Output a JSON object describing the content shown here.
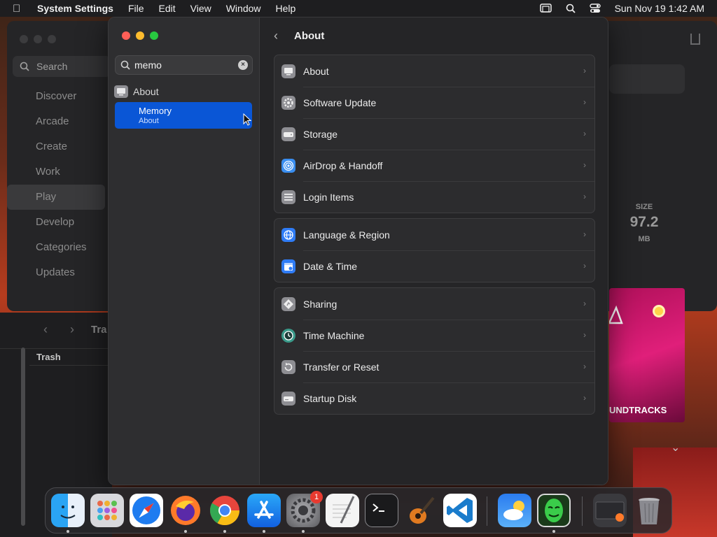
{
  "menubar": {
    "app": "System Settings",
    "items": [
      "File",
      "Edit",
      "View",
      "Window",
      "Help"
    ],
    "clock": "Sun Nov 19  1:42 AM"
  },
  "store": {
    "search_placeholder": "Search",
    "nav": [
      "Discover",
      "Arcade",
      "Create",
      "Work",
      "Play",
      "Develop",
      "Categories",
      "Updates"
    ],
    "selected_nav": "Play",
    "size_label": "SIZE",
    "size_value": "97.2",
    "size_unit": "MB",
    "art_text": "UNDTRACKS"
  },
  "finder": {
    "title": "Tra",
    "column_header": "Trash"
  },
  "settings": {
    "search_value": "memo",
    "sidebar_result": "About",
    "selected_result": {
      "title": "Memory",
      "subtitle": "About"
    },
    "header_title": "About",
    "groups": [
      [
        {
          "label": "About",
          "icon": "display-icon",
          "color": "#8e8e93"
        },
        {
          "label": "Software Update",
          "icon": "gear-icon",
          "color": "#8e8e93"
        },
        {
          "label": "Storage",
          "icon": "drive-icon",
          "color": "#8e8e93"
        },
        {
          "label": "AirDrop & Handoff",
          "icon": "airdrop-icon",
          "color": "#3a8ef0"
        },
        {
          "label": "Login Items",
          "icon": "list-icon",
          "color": "#8e8e93"
        }
      ],
      [
        {
          "label": "Language & Region",
          "icon": "globe-icon",
          "color": "#2f7cf6"
        },
        {
          "label": "Date & Time",
          "icon": "calendar-icon",
          "color": "#2f7cf6"
        }
      ],
      [
        {
          "label": "Sharing",
          "icon": "sharing-icon",
          "color": "#8e8e93"
        },
        {
          "label": "Time Machine",
          "icon": "time-machine-icon",
          "color": "#3a9a8a"
        },
        {
          "label": "Transfer or Reset",
          "icon": "reset-icon",
          "color": "#8e8e93"
        },
        {
          "label": "Startup Disk",
          "icon": "disk-icon",
          "color": "#8e8e93"
        }
      ]
    ]
  },
  "dock": {
    "apps": [
      {
        "name": "finder-icon",
        "color": "#2a8cf0"
      },
      {
        "name": "launchpad-icon",
        "color": "#c8c8cc"
      },
      {
        "name": "safari-icon",
        "color": "#1e7cf0"
      },
      {
        "name": "firefox-icon",
        "color": "#ff7a2a"
      },
      {
        "name": "chrome-icon",
        "color": "#ffffff"
      },
      {
        "name": "app-store-icon",
        "color": "#1a8cf5"
      },
      {
        "name": "system-settings-icon",
        "color": "#8a8a8e"
      },
      {
        "name": "textedit-icon",
        "color": "#f2f2f2"
      },
      {
        "name": "terminal-icon",
        "color": "#1a1a1a"
      },
      {
        "name": "garageband-icon",
        "color": "#e07a20"
      },
      {
        "name": "vscode-icon",
        "color": "#ffffff"
      },
      {
        "name": "weather-icon",
        "color": "#3a8af0"
      },
      {
        "name": "hacker-mask-icon",
        "color": "#2a8a3a"
      },
      {
        "name": "minimized-window-icon",
        "color": "#3a3a3e"
      },
      {
        "name": "trash-icon",
        "color": "#9a9aa0"
      }
    ],
    "settings_badge": "1"
  }
}
